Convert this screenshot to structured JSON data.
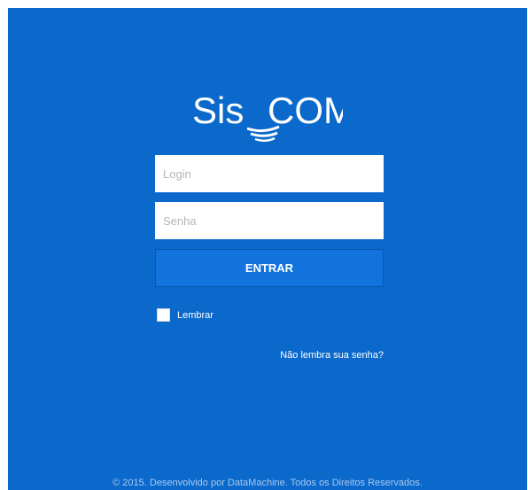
{
  "brand": {
    "logo_prefix": "Sis",
    "logo_suffix": "COM"
  },
  "form": {
    "login_placeholder": "Login",
    "login_value": "",
    "password_placeholder": "Senha",
    "password_value": "",
    "submit_label": "ENTRAR",
    "remember_label": "Lembrar",
    "remember_checked": false,
    "forgot_link": "Não lembra sua senha?"
  },
  "footer": {
    "text": "© 2015. Desenvolvido por DataMachine. Todos os Direitos Reservados."
  },
  "colors": {
    "background": "#0b69cc",
    "button": "#1273de",
    "text": "#ffffff"
  }
}
